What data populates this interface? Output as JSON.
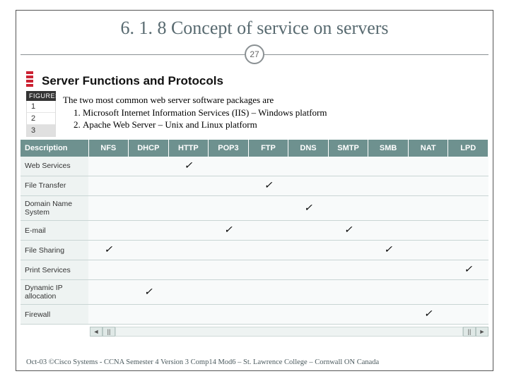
{
  "title": "6. 1. 8  Concept of service on servers",
  "page_number": "27",
  "section_header": "Server Functions and Protocols",
  "figures": {
    "label": "FIGURES",
    "tabs": [
      "1",
      "2",
      "3"
    ]
  },
  "body": {
    "intro": "The two most common web server software packages are",
    "items": [
      "Microsoft Internet Information Services (IIS) – Windows platform",
      "Apache Web Server – Unix and Linux platform"
    ]
  },
  "table": {
    "columns": [
      "Description",
      "NFS",
      "DHCP",
      "HTTP",
      "POP3",
      "FTP",
      "DNS",
      "SMTP",
      "SMB",
      "NAT",
      "LPD"
    ],
    "rows": [
      {
        "label": "Web Services",
        "protocols": [
          "HTTP"
        ]
      },
      {
        "label": "File Transfer",
        "protocols": [
          "FTP"
        ]
      },
      {
        "label": "Domain Name System",
        "protocols": [
          "DNS"
        ]
      },
      {
        "label": "E-mail",
        "protocols": [
          "POP3",
          "SMTP"
        ]
      },
      {
        "label": "File Sharing",
        "protocols": [
          "NFS",
          "SMB"
        ]
      },
      {
        "label": "Print Services",
        "protocols": [
          "LPD"
        ]
      },
      {
        "label": "Dynamic IP allocation",
        "protocols": [
          "DHCP"
        ]
      },
      {
        "label": "Firewall",
        "protocols": [
          "NAT"
        ]
      }
    ]
  },
  "scroll": {
    "left": "◄",
    "pause_l": "||",
    "pause_r": "||",
    "right": "►"
  },
  "footer": "Oct-03 ©Cisco Systems - CCNA Semester 4 Version 3 Comp14 Mod6 – St. Lawrence College – Cornwall ON Canada",
  "chart_data": {
    "type": "table",
    "title": "Server Functions and Protocols",
    "columns": [
      "NFS",
      "DHCP",
      "HTTP",
      "POP3",
      "FTP",
      "DNS",
      "SMTP",
      "SMB",
      "NAT",
      "LPD"
    ],
    "rows": [
      "Web Services",
      "File Transfer",
      "Domain Name System",
      "E-mail",
      "File Sharing",
      "Print Services",
      "Dynamic IP allocation",
      "Firewall"
    ],
    "matrix": [
      [
        0,
        0,
        1,
        0,
        0,
        0,
        0,
        0,
        0,
        0
      ],
      [
        0,
        0,
        0,
        0,
        1,
        0,
        0,
        0,
        0,
        0
      ],
      [
        0,
        0,
        0,
        0,
        0,
        1,
        0,
        0,
        0,
        0
      ],
      [
        0,
        0,
        0,
        1,
        0,
        0,
        1,
        0,
        0,
        0
      ],
      [
        1,
        0,
        0,
        0,
        0,
        0,
        0,
        1,
        0,
        0
      ],
      [
        0,
        0,
        0,
        0,
        0,
        0,
        0,
        0,
        0,
        1
      ],
      [
        0,
        1,
        0,
        0,
        0,
        0,
        0,
        0,
        0,
        0
      ],
      [
        0,
        0,
        0,
        0,
        0,
        0,
        0,
        0,
        1,
        0
      ]
    ]
  }
}
